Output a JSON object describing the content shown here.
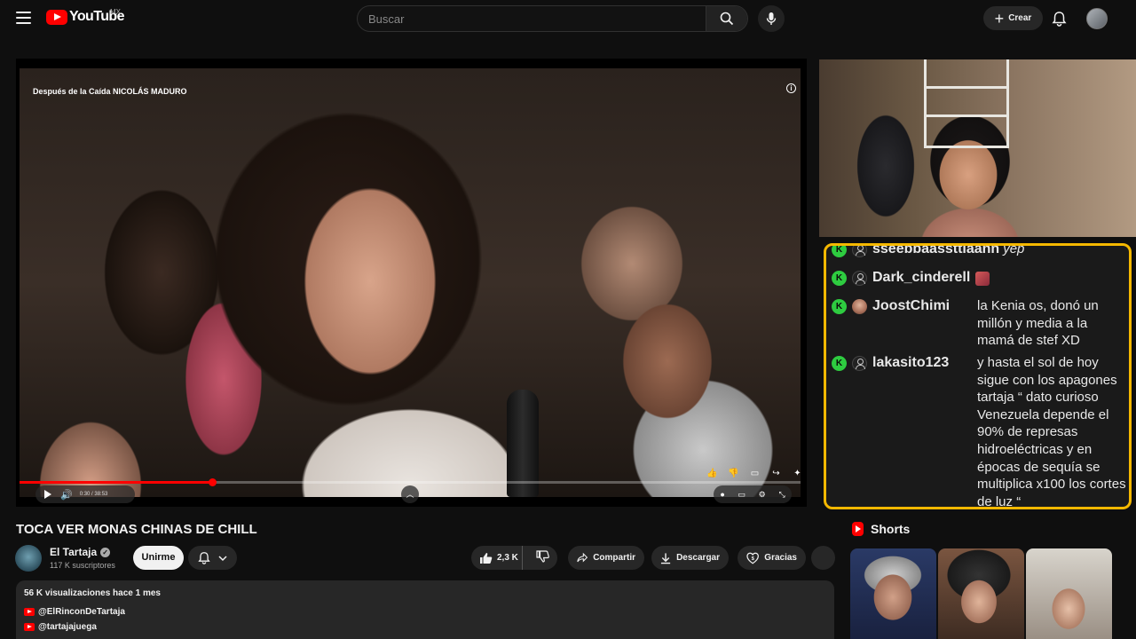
{
  "header": {
    "logo_text": "YouTube",
    "region": "MX",
    "search_placeholder": "Buscar",
    "create_label": "Crear"
  },
  "player": {
    "overlay_title": "Después de la Caída NICOLÁS MADURO",
    "time": "0:30 / 38:53",
    "progress_fraction": 0.247
  },
  "chat": {
    "messages": [
      {
        "user": "sseebbaassttiaann",
        "text": "yep"
      },
      {
        "user": "Dark_cinderell",
        "text": ""
      },
      {
        "user": "JoostChimi",
        "text": "la Kenia os, donó un millón y media a la mamá de stef XD"
      },
      {
        "user": "lakasito123",
        "text": "y hasta el sol de hoy sigue con los apagones tartaja “ dato curioso Venezuela depende el 90% de represas hidroeléctricas y en épocas de sequía se multiplica x100 los cortes de luz “"
      }
    ],
    "badge": "K",
    "border_color": "#f5b800"
  },
  "video": {
    "title": "TOCA VER MONAS CHINAS DE CHILL",
    "channel_name": "El Tartaja",
    "subscribers": "117 K suscriptores",
    "join_label": "Unirme",
    "likes": "2,3 K",
    "share_label": "Compartir",
    "download_label": "Descargar",
    "thanks_label": "Gracias"
  },
  "description": {
    "meta": "56 K visualizaciones  hace 1 mes",
    "links": [
      "@ElRinconDeTartaja",
      "@tartajajuega"
    ]
  },
  "shorts": {
    "heading": "Shorts"
  },
  "colors": {
    "accent": "#ff0000",
    "background": "#0f0f0f",
    "pill": "#272727"
  }
}
